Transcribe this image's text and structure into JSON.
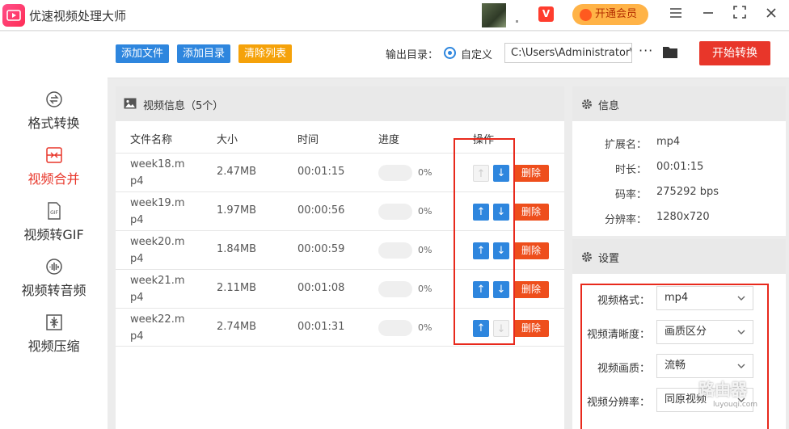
{
  "app": {
    "title": "优速视频处理大师",
    "vip_label": "开通会员"
  },
  "sidebar": {
    "items": [
      {
        "label": "格式转换",
        "active": false
      },
      {
        "label": "视频合并",
        "active": true
      },
      {
        "label": "视频转GIF",
        "active": false
      },
      {
        "label": "视频转音频",
        "active": false
      },
      {
        "label": "视频压缩",
        "active": false
      }
    ]
  },
  "toolbar": {
    "add_file": "添加文件",
    "add_dir": "添加目录",
    "clear_list": "清除列表",
    "output_label": "输出目录：",
    "custom_label": "自定义",
    "output_path": "C:\\Users\\Administrator\\",
    "browse_label": "···",
    "start_label": "开始转换"
  },
  "file_panel": {
    "title": "视频信息（5个）",
    "columns": {
      "name": "文件名称",
      "size": "大小",
      "time": "时间",
      "progress": "进度",
      "actions": "操作"
    },
    "delete_label": "删除",
    "rows": [
      {
        "name": "week18.mp4",
        "size": "2.47MB",
        "time": "00:01:15",
        "progress": 0,
        "progress_text": "0%",
        "up_enabled": false,
        "down_enabled": true
      },
      {
        "name": "week19.mp4",
        "size": "1.97MB",
        "time": "00:00:56",
        "progress": 0,
        "progress_text": "0%",
        "up_enabled": true,
        "down_enabled": true
      },
      {
        "name": "week20.mp4",
        "size": "1.84MB",
        "time": "00:00:59",
        "progress": 0,
        "progress_text": "0%",
        "up_enabled": true,
        "down_enabled": true
      },
      {
        "name": "week21.mp4",
        "size": "2.11MB",
        "time": "00:01:08",
        "progress": 0,
        "progress_text": "0%",
        "up_enabled": true,
        "down_enabled": true
      },
      {
        "name": "week22.mp4",
        "size": "2.74MB",
        "time": "00:01:31",
        "progress": 0,
        "progress_text": "0%",
        "up_enabled": true,
        "down_enabled": false
      }
    ]
  },
  "info": {
    "title": "信息",
    "fields": [
      {
        "key": "扩展名：",
        "value": "mp4"
      },
      {
        "key": "时长：",
        "value": "00:01:15"
      },
      {
        "key": "码率：",
        "value": "275292 bps"
      },
      {
        "key": "分辨率：",
        "value": "1280x720"
      }
    ]
  },
  "settings": {
    "title": "设置",
    "fields": [
      {
        "key": "视频格式：",
        "value": "mp4"
      },
      {
        "key": "视频清晰度：",
        "value": "画质区分"
      },
      {
        "key": "视频画质：",
        "value": "流畅"
      },
      {
        "key": "视频分辨率：",
        "value": "同原视频"
      }
    ]
  },
  "watermark": {
    "text": "路由器",
    "sub": "luyouqi.com"
  },
  "colors": {
    "accent": "#e8362a",
    "blue": "#2e86de",
    "orange": "#f5a20a",
    "vip": "#ffb347"
  }
}
